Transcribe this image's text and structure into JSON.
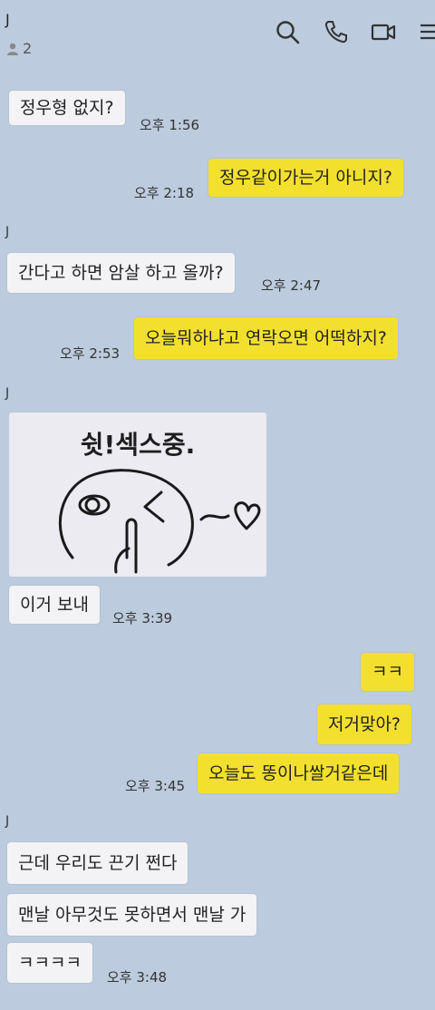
{
  "header": {
    "title": "J",
    "member_count": "2",
    "icons": [
      "search-icon",
      "phone-icon",
      "video-call-icon",
      "menu-icon"
    ]
  },
  "sticker": {
    "text": "쉿!섹스중."
  },
  "messages": {
    "m1": {
      "sender": "J",
      "text": "정우형 없지?",
      "time": "오후 1:56"
    },
    "m2": {
      "text": "정우같이가는거 아니지?",
      "time": "오후 2:18"
    },
    "m3": {
      "sender": "J",
      "text": "간다고 하면 암살 하고 올까?",
      "time": "오후 2:47"
    },
    "m4": {
      "text": "오늘뭐하냐고 연락오면 어떡하지?",
      "time": "오후 2:53"
    },
    "m5": {
      "sender": "J",
      "text": "이거 보내",
      "time": "오후 3:39"
    },
    "m6": {
      "text": "ㅋㅋ"
    },
    "m7": {
      "text": "저거맞아?"
    },
    "m8": {
      "text": "오늘도 똥이나쌀거같은데",
      "time": "오후 3:45"
    },
    "m9": {
      "sender": "J",
      "text": "근데 우리도 끈기 쩐다"
    },
    "m10": {
      "text": "맨날 아무것도 못하면서 맨날 가"
    },
    "m11": {
      "text": "ㅋㅋㅋㅋ",
      "time": "오후 3:48"
    }
  },
  "colors": {
    "background": "#bccbdd",
    "incoming_bubble": "#f3f3f5",
    "outgoing_bubble": "#f3e02e"
  }
}
